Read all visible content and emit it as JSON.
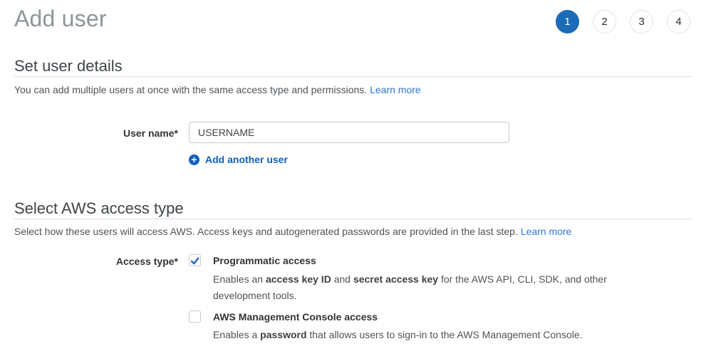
{
  "colors": {
    "link_blue": "#2d78d7",
    "action_blue": "#0d5fbe",
    "step_active_blue": "#1b6bb7",
    "check_blue": "#1b6bb7",
    "title_gray": "#8d9598",
    "heading_gray": "#3f4448",
    "body_gray": "#4e5358",
    "label_dark": "#333333",
    "divider_gray": "#dddddd",
    "input_border": "#c5cacc",
    "checkbox_border": "#c9c9c9",
    "step_inactive_border": "#e0e4e4"
  },
  "header": {
    "title": "Add user",
    "steps": [
      {
        "label": "1",
        "active": true
      },
      {
        "label": "2",
        "active": false
      },
      {
        "label": "3",
        "active": false
      },
      {
        "label": "4",
        "active": false
      }
    ]
  },
  "user_details": {
    "section_title": "Set user details",
    "description": "You can add multiple users at once with the same access type and permissions.",
    "learn_more_label": "Learn more",
    "username_label": "User name*",
    "username_value": "USERNAME",
    "add_another_user_label": "Add another user"
  },
  "access_type": {
    "section_title": "Select AWS access type",
    "description": "Select how these users will access AWS. Access keys and autogenerated passwords are provided in the last step.",
    "learn_more_label": "Learn more",
    "field_label": "Access type*",
    "options": [
      {
        "label": "Programmatic access",
        "checked": true,
        "description_segments": [
          {
            "text": "Enables an ",
            "bold": false
          },
          {
            "text": "access key ID",
            "bold": true
          },
          {
            "text": " and ",
            "bold": false
          },
          {
            "text": "secret access key",
            "bold": true
          },
          {
            "text": " for the AWS API, CLI, SDK, and other development tools.",
            "bold": false
          }
        ]
      },
      {
        "label": "AWS Management Console access",
        "checked": false,
        "description_segments": [
          {
            "text": "Enables a ",
            "bold": false
          },
          {
            "text": "password",
            "bold": true
          },
          {
            "text": " that allows users to sign-in to the AWS Management Console.",
            "bold": false
          }
        ]
      }
    ]
  }
}
